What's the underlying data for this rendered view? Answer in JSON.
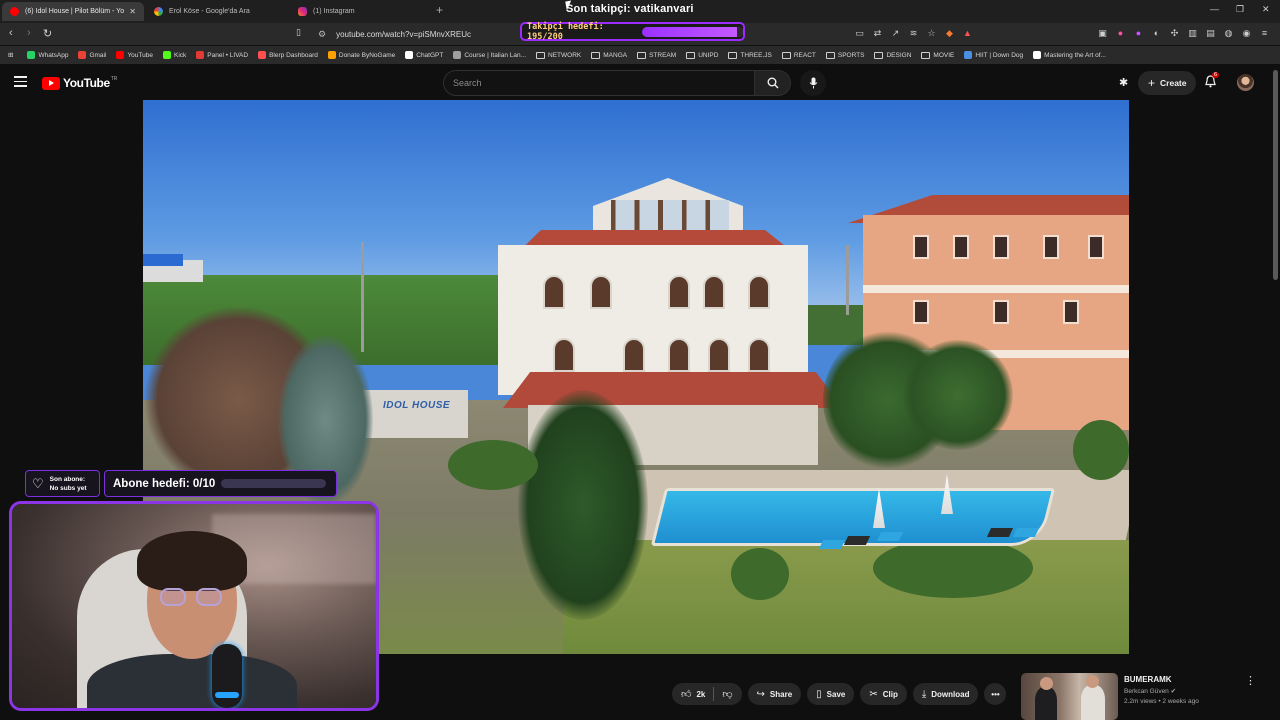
{
  "browser": {
    "tabs": [
      {
        "label": "(6) Idol House | Pilot Bölüm - Yo",
        "icon": "youtube-icon",
        "active": true
      },
      {
        "label": "Erol Köse - Google'da Ara",
        "icon": "google-icon",
        "active": false
      },
      {
        "label": "(1) Instagram",
        "icon": "instagram-icon",
        "active": false
      }
    ],
    "url": "youtube.com/watch?v=piSMnvXREUc",
    "bookmarks": [
      {
        "label": "WhatsApp",
        "color": "#25d366"
      },
      {
        "label": "Gmail",
        "color": "#ea4335"
      },
      {
        "label": "YouTube",
        "color": "#ff0000"
      },
      {
        "label": "Kick",
        "color": "#53fc18"
      },
      {
        "label": "Panel • LIVAD",
        "color": "#e53935"
      },
      {
        "label": "Blerp Dashboard",
        "color": "#ff4f4f"
      },
      {
        "label": "Donate ByNoGame",
        "color": "#ffa000"
      },
      {
        "label": "ChatGPT",
        "color": "#ffffff"
      },
      {
        "label": "Course | Italian Lan...",
        "color": "#9e9e9e"
      },
      {
        "label": "NETWORK",
        "folder": true
      },
      {
        "label": "MANGA",
        "folder": true
      },
      {
        "label": "STREAM",
        "folder": true
      },
      {
        "label": "UNIPD",
        "folder": true
      },
      {
        "label": "THREE.JS",
        "folder": true
      },
      {
        "label": "REACT",
        "folder": true
      },
      {
        "label": "SPORTS",
        "folder": true
      },
      {
        "label": "DESIGN",
        "folder": true
      },
      {
        "label": "MOVIE",
        "folder": true
      },
      {
        "label": "HIIT | Down Dog",
        "color": "#4a90e2"
      },
      {
        "label": "Mastering the Art of...",
        "color": "#ffffff"
      }
    ]
  },
  "stream": {
    "last_follower": "Son takipçi: vatikanvari",
    "follower_goal": "Takipçi hedefi: 195/200",
    "follower_goal_progress": 0.975,
    "last_sub_title": "Son abone:",
    "last_sub_value": "No subs yet",
    "sub_goal": "Abone hedefi: 0/10",
    "sub_goal_progress": 0.0
  },
  "youtube": {
    "logo_text": "YouTube",
    "country_code": "TR",
    "search_placeholder": "Search",
    "create_label": "Create",
    "notification_count": "6",
    "actions": {
      "likes": "2k",
      "share": "Share",
      "save": "Save",
      "clip": "Clip",
      "download": "Download"
    },
    "recommendation": {
      "title": "BUMERAMK",
      "channel": "Berkcan Güven",
      "meta": "2.2m views • 2 weeks ago"
    }
  },
  "video_scene": {
    "wall_logo": "IDOL HOUSE"
  }
}
